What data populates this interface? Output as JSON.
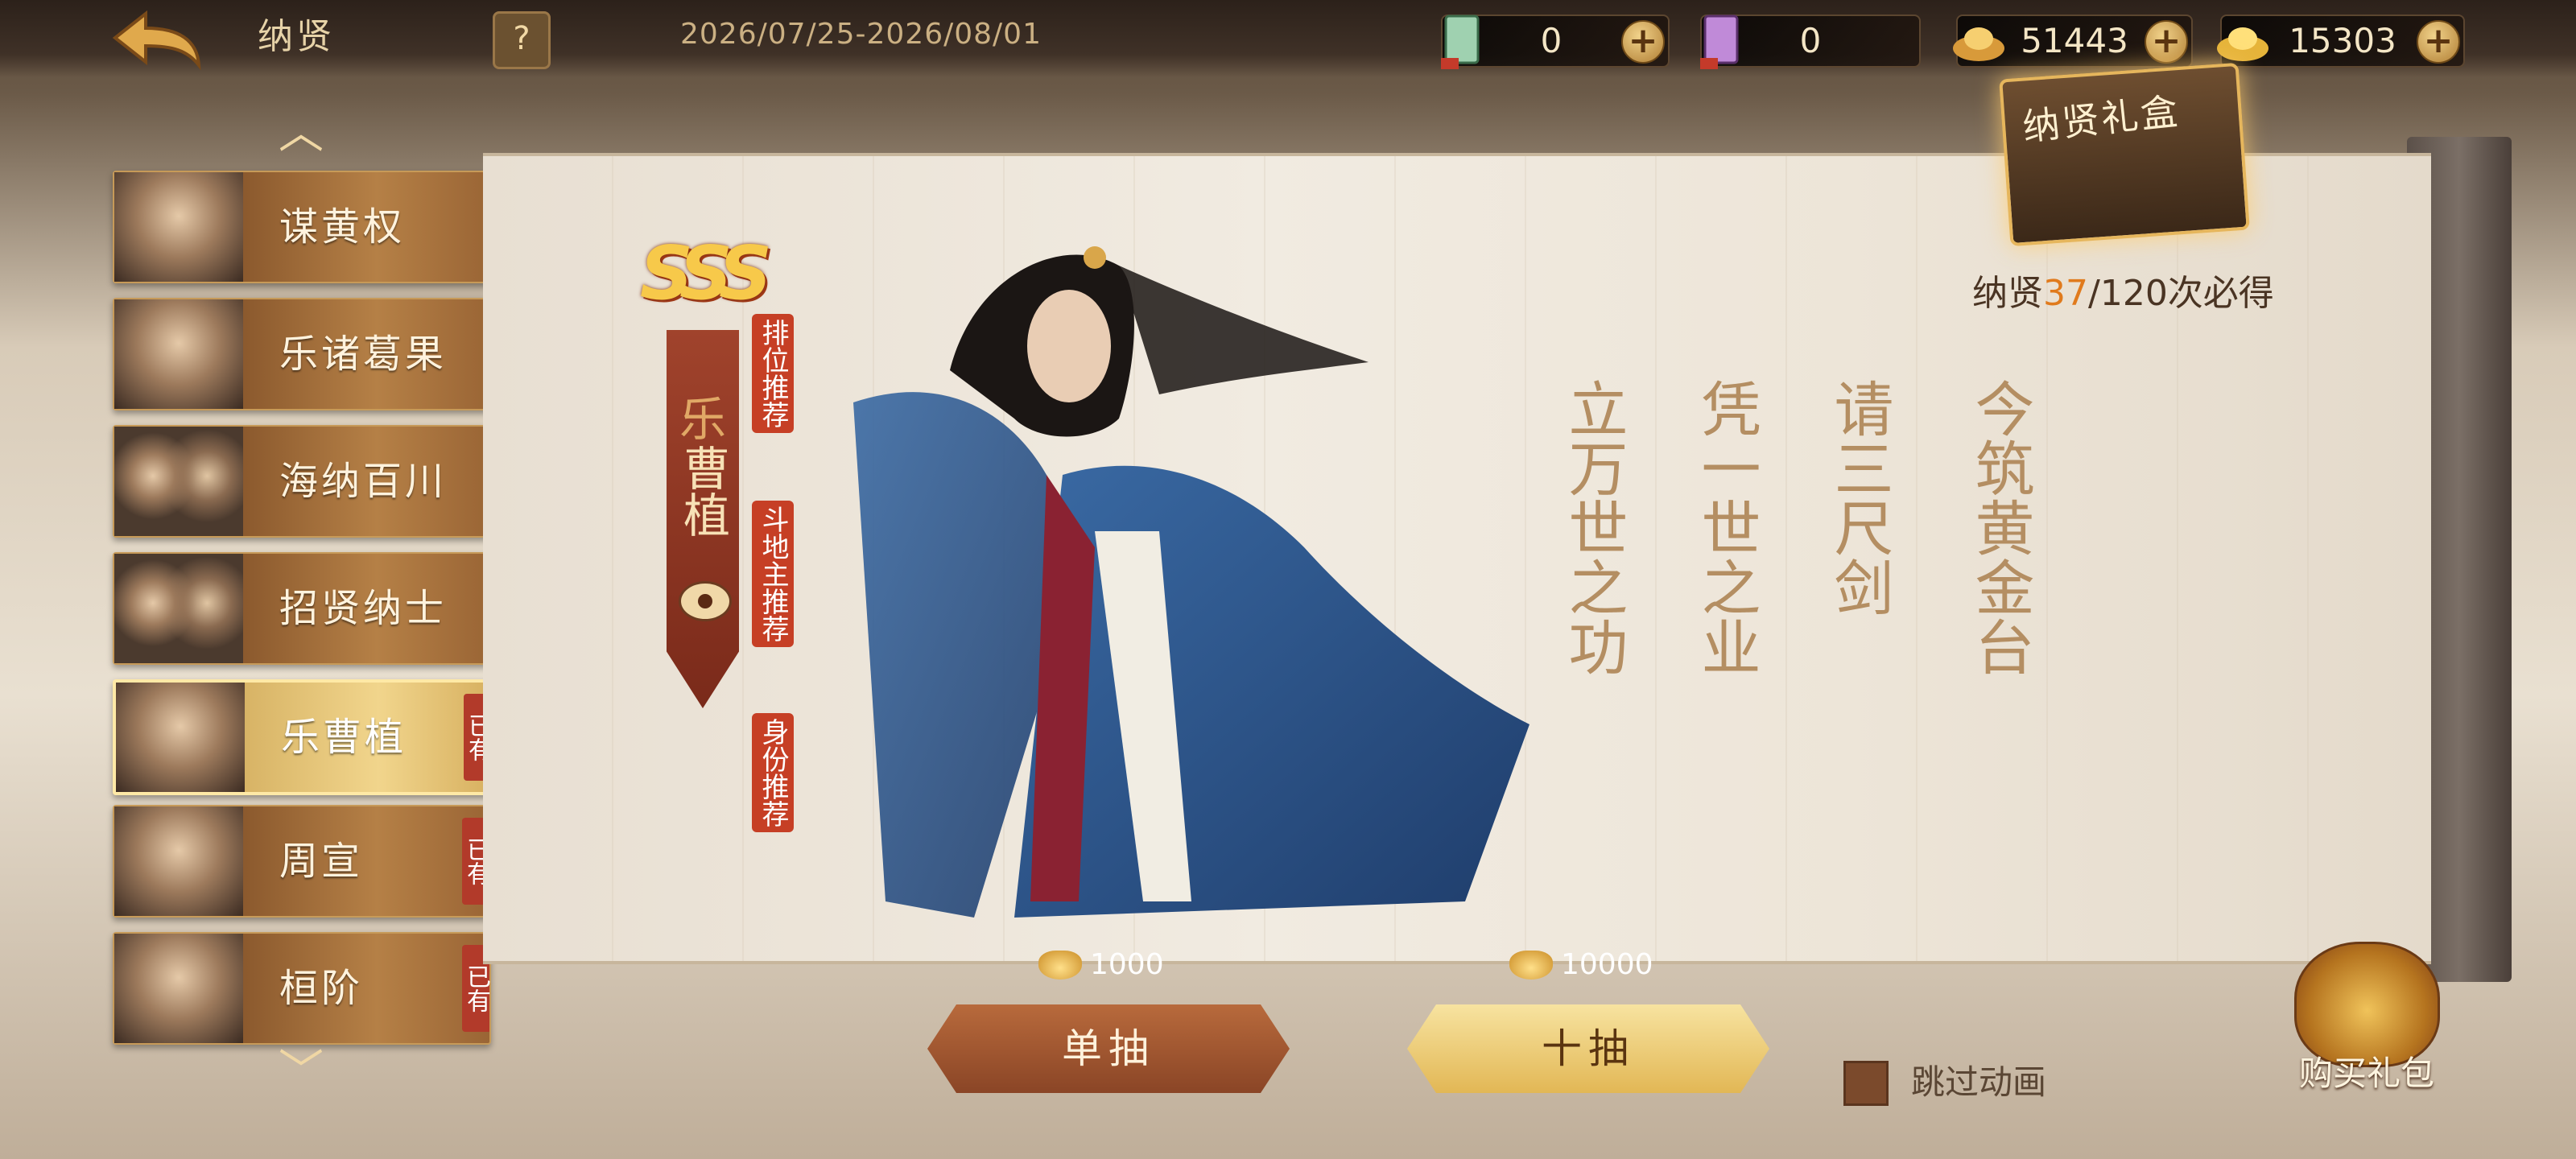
{
  "header": {
    "title": "纳贤",
    "help_label": "?",
    "date_range": "2026/07/25-2026/08/01"
  },
  "resources": [
    {
      "name": "recruit-token-green",
      "value": "0",
      "color": "#8fc6a4"
    },
    {
      "name": "recruit-token-purple",
      "value": "0",
      "color": "#b07acb"
    },
    {
      "name": "silver-ingot",
      "value": "51443",
      "color": "#e2b04a"
    },
    {
      "name": "gold-ingot",
      "value": "15303",
      "color": "#f2c84a"
    }
  ],
  "sidebar": {
    "items": [
      {
        "label": "谋黄权",
        "owned": false
      },
      {
        "label": "乐诸葛果",
        "owned": false
      },
      {
        "label": "海纳百川",
        "owned": false
      },
      {
        "label": "招贤纳士",
        "owned": false
      },
      {
        "label": "乐曹植",
        "owned": true,
        "selected": true
      },
      {
        "label": "周宣",
        "owned": true
      },
      {
        "label": "桓阶",
        "owned": true
      }
    ],
    "owned_label": "已有"
  },
  "hero": {
    "rank": "SSS",
    "name_first": "乐",
    "name_rest": "曹植",
    "tags": [
      "排位推荐",
      "斗地主推荐",
      "身份推荐"
    ]
  },
  "poem": {
    "columns": [
      "立万世之功",
      "凭一世之业",
      "请三尺剑",
      "今筑黄金台"
    ]
  },
  "gift_box": {
    "label": "纳贤礼盒"
  },
  "guarantee": {
    "prefix": "纳贤",
    "current": "37",
    "suffix": "/120次必得"
  },
  "draws": {
    "single": {
      "label": "单抽",
      "cost": "1000"
    },
    "ten": {
      "label": "十抽",
      "cost": "10000"
    }
  },
  "skip_animation": {
    "label": "跳过动画",
    "checked": false
  },
  "buy_pack": {
    "label": "购买礼包"
  }
}
